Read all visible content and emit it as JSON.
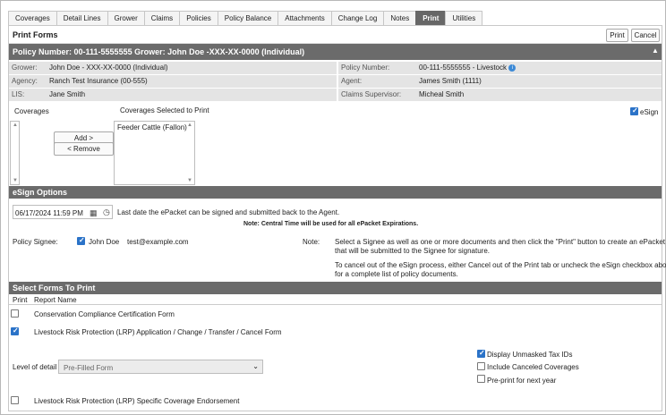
{
  "tabs": [
    "Coverages",
    "Detail Lines",
    "Grower",
    "Claims",
    "Policies",
    "Policy Balance",
    "Attachments",
    "Change Log",
    "Notes",
    "Print",
    "Utilities"
  ],
  "active_tab": "Print",
  "panel": {
    "title": "Print Forms",
    "print_label": "Print",
    "cancel_label": "Cancel"
  },
  "policy_header": "Policy Number: 00-111-5555555 Grower: John Doe -XXX-XX-0000 (Individual)",
  "collapse_icon": "triangle-up-icon",
  "info": {
    "grower_label": "Grower:",
    "grower": "John Doe - XXX-XX-0000 (Individual)",
    "policy_number_label": "Policy Number:",
    "policy_number": "00-111-5555555 - Livestock",
    "agency_label": "Agency:",
    "agency": "Ranch Test Insurance (00-555)",
    "agent_label": "Agent:",
    "agent": "James Smith (1111)",
    "lis_label": "LIS:",
    "lis": "Jane Smith",
    "claims_supervisor_label": "Claims Supervisor:",
    "claims_supervisor": "Micheal Smith"
  },
  "coverages": {
    "coverages_label": "Coverages",
    "selected_label": "Coverages Selected to Print",
    "add_label": "Add >",
    "remove_label": "< Remove",
    "selected_items": [
      "Feeder Cattle (Fallon)"
    ],
    "esign_label": "eSign"
  },
  "esign": {
    "header": "eSign Options",
    "date_value": "06/17/2024 11:59 PM",
    "date_desc": "Last date the ePacket can be signed and submitted back to the Agent.",
    "central_note": "Note: Central Time will be used for all ePacket Expirations.",
    "signee_label": "Policy Signee:",
    "signee_name": "John Doe",
    "signee_email": "test@example.com",
    "note_label": "Note:",
    "note_line1": "Select a Signee as well as one or more documents and then click the \"Print\" button to create an ePacket",
    "note_line2": "that will be submitted to the Signee for signature.",
    "note_line3": "To cancel out of the eSign process, either Cancel out of the Print tab or uncheck the eSign checkbox above",
    "note_line4": "for a complete list of policy documents."
  },
  "forms": {
    "header": "Select Forms To Print",
    "col_print": "Print",
    "col_report": "Report Name",
    "rows": [
      {
        "name": "Conservation Compliance Certification Form",
        "checked": false
      },
      {
        "name": "Livestock Risk Protection (LRP) Application / Change / Transfer / Cancel Form",
        "checked": true
      },
      {
        "name": "Livestock Risk Protection (LRP) Specific Coverage Endorsement",
        "checked": false
      }
    ],
    "level_label": "Level of detail",
    "level_value": "Pre-Filled Form",
    "opt_unmasked": "Display Unmasked Tax IDs",
    "opt_canceled": "Include Canceled Coverages",
    "opt_preprint": "Pre-print for next year"
  }
}
